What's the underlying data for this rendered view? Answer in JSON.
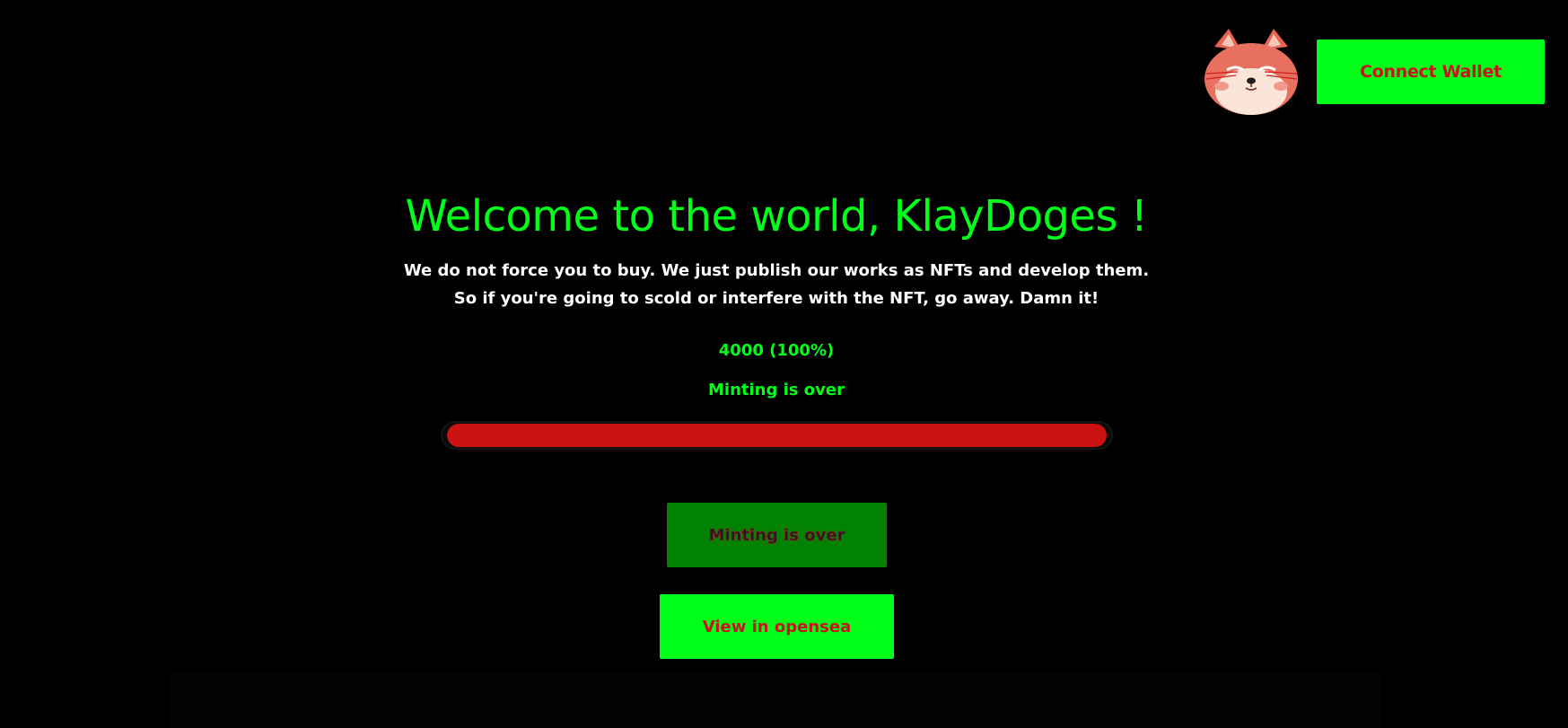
{
  "header": {
    "mascot_icon": "shiba-dog-mascot-icon",
    "connect_wallet_label": "Connect Wallet"
  },
  "hero": {
    "title": "Welcome to the world, KlayDoges !",
    "description_line1": "We do not force you to buy. We just publish our works as NFTs and develop them.",
    "description_line2": "So if you're going to scold or interfere with the NFT, go away. Damn it!",
    "counter": "4000 (100%)",
    "status": "Minting is over"
  },
  "progress": {
    "fraction": 1.0,
    "fill_color": "#cc1111"
  },
  "actions": {
    "mint_label": "Minting is over",
    "opensea_label": "View in opensea"
  },
  "colors": {
    "accent": "#00ff19",
    "button_text": "#c8141b",
    "background": "#000000"
  }
}
